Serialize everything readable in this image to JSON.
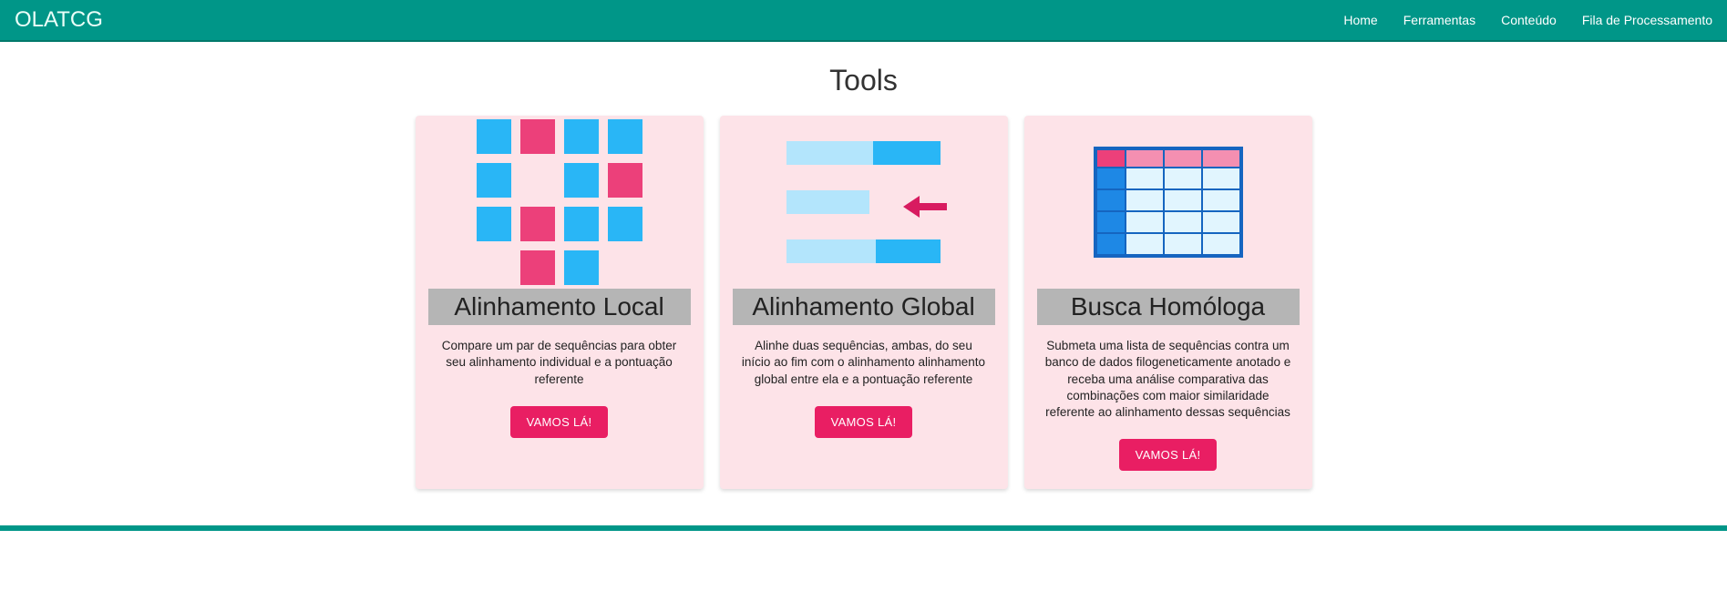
{
  "nav": {
    "brand": "OLATCG",
    "links": [
      "Home",
      "Ferramentas",
      "Conteúdo",
      "Fila de Processamento"
    ]
  },
  "page_title": "Tools",
  "cards": [
    {
      "title": "Alinhamento Local",
      "desc": "Compare um par de sequências para obter seu alinhamento individual e a pontuação referente",
      "button": "VAMOS LÁ!"
    },
    {
      "title": "Alinhamento Global",
      "desc": "Alinhe duas sequências, ambas, do seu início ao fim com o alinhamento alinhamento global entre ela e a pontuação referente",
      "button": "VAMOS LÁ!"
    },
    {
      "title": "Busca Homóloga",
      "desc": "Submeta uma lista de sequências contra um banco de dados filogeneticamente anotado e receba uma análise comparativa das combinações com maior similaridade referente ao alinhamento dessas sequências",
      "button": "VAMOS LÁ!"
    }
  ]
}
